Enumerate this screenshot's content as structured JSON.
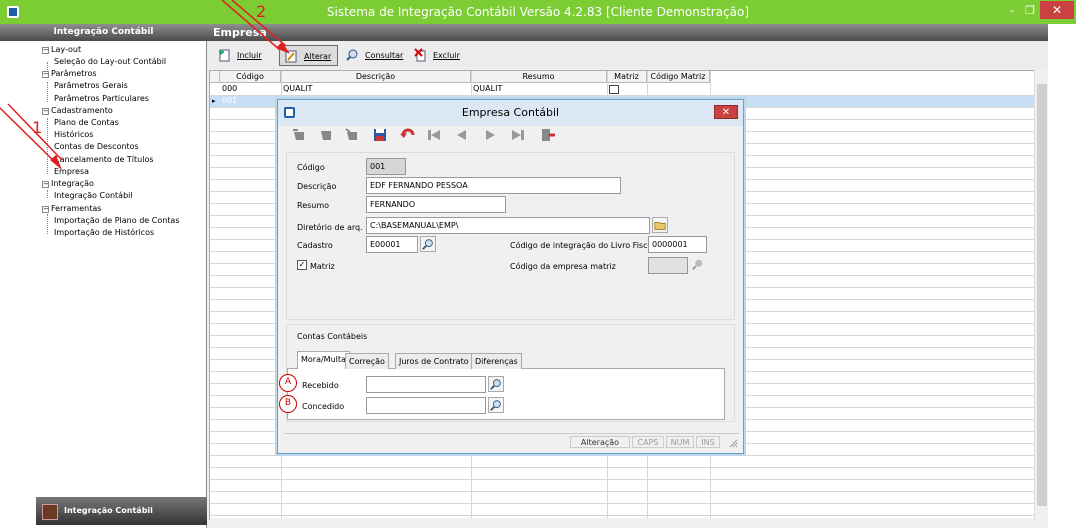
{
  "window": {
    "title": "Sistema de Integração Contábil Versão 4.2.83 [Cliente Demonstração]",
    "minimize": "–",
    "restore": "❐",
    "close": "✕"
  },
  "sidebar": {
    "header": "Integração Contábil",
    "groups": [
      {
        "label": "Lay-out",
        "items": [
          "Seleção do Lay-out Contábil"
        ]
      },
      {
        "label": "Parâmetros",
        "items": [
          "Parâmetros Gerais",
          "Parâmetros Particulares"
        ]
      },
      {
        "label": "Cadastramento",
        "items": [
          "Plano de Contas",
          "Históricos",
          "Contas de Descontos",
          "Cancelamento de Títulos",
          "Empresa"
        ]
      },
      {
        "label": "Integração",
        "items": [
          "Integração Contábil"
        ]
      },
      {
        "label": "Ferramentas",
        "items": [
          "Importação de Plano de Contas",
          "Importação de Históricos"
        ]
      }
    ],
    "footer": "Integração Contábil"
  },
  "panel": {
    "title": "Empresa"
  },
  "toolbar": {
    "incluir": "Incluir",
    "alterar": "Alterar",
    "consultar": "Consultar",
    "excluir": "Excluir"
  },
  "grid": {
    "headers": [
      "Código",
      "Descrição",
      "Resumo",
      "Matriz",
      "Código Matriz"
    ],
    "rows": [
      {
        "codigo": "000",
        "descricao": "QUALIT",
        "resumo": "QUALIT"
      },
      {
        "codigo": "001",
        "descricao": "",
        "resumo": ""
      }
    ]
  },
  "dialog": {
    "title": "Empresa Contábil",
    "close": "✕",
    "labels": {
      "codigo": "Código",
      "descricao": "Descrição",
      "resumo": "Resumo",
      "diretorio": "Diretório de arq.",
      "cadastro": "Cadastro",
      "matriz": "Matriz",
      "cod_livro": "Código de integração do Livro Fiscal",
      "cod_matriz": "Código da empresa matriz",
      "contas": "Contas Contábeis",
      "recebido": "Recebido",
      "concedido": "Concedido"
    },
    "values": {
      "codigo": "001",
      "descricao": "EDF FERNANDO PESSOA",
      "resumo": "FERNANDO",
      "diretorio": "C:\\BASEMANUAL\\EMP\\",
      "cadastro": "E00001",
      "cod_livro": "0000001",
      "matriz_checked": true,
      "checkmark": "✓"
    },
    "tabs": [
      "Mora/Multa",
      "Correção",
      "Juros de Contrato",
      "Diferenças"
    ],
    "status": {
      "mode": "Alteração",
      "caps": "CAPS",
      "num": "NUM",
      "ins": "INS"
    }
  },
  "annotations": {
    "one": "1",
    "two": "2",
    "a": "A",
    "b": "B"
  }
}
